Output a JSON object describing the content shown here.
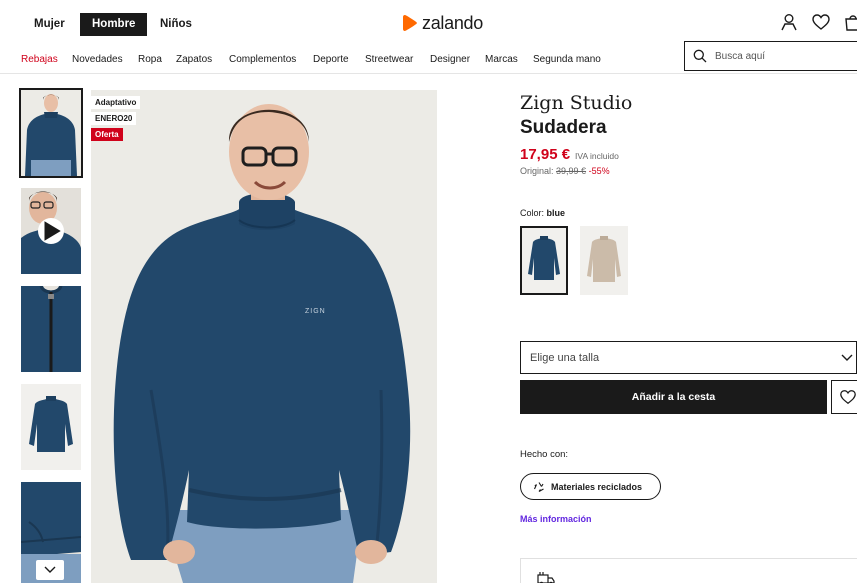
{
  "header": {
    "genders": [
      {
        "label": "Mujer",
        "active": false
      },
      {
        "label": "Hombre",
        "active": true
      },
      {
        "label": "Niños",
        "active": false
      }
    ],
    "logo_text": "zalando",
    "icons": [
      "user-icon",
      "heart-icon",
      "bag-icon"
    ]
  },
  "categories": [
    "Rebajas",
    "Novedades",
    "Ropa",
    "Zapatos",
    "Complementos",
    "Deporte",
    "Streetwear",
    "Designer",
    "Marcas",
    "Segunda mano"
  ],
  "search": {
    "placeholder": "Busca aquí"
  },
  "badges": {
    "adaptive": "Adaptativo",
    "code": "ENERO20",
    "offer": "Oferta"
  },
  "main_image_print": "ZIGN",
  "product": {
    "brand": "Zign Studio",
    "name": "Sudadera",
    "price": "17,95 €",
    "vat": "IVA incluido",
    "original_label": "Original:",
    "original_price": "39,99 €",
    "discount": "-55%",
    "color_label": "Color:",
    "color_value": "blue"
  },
  "size_select": {
    "label": "Elige una talla"
  },
  "add_to_cart": "Añadir a la cesta",
  "made_with": {
    "label": "Hecho con:",
    "pill": "Materiales reciclados",
    "more": "Más información"
  },
  "colors": {
    "accent": "#d0021b",
    "brand": "#ff6900",
    "link": "#6328e0",
    "sweatshirt_blue": "#22486b"
  }
}
